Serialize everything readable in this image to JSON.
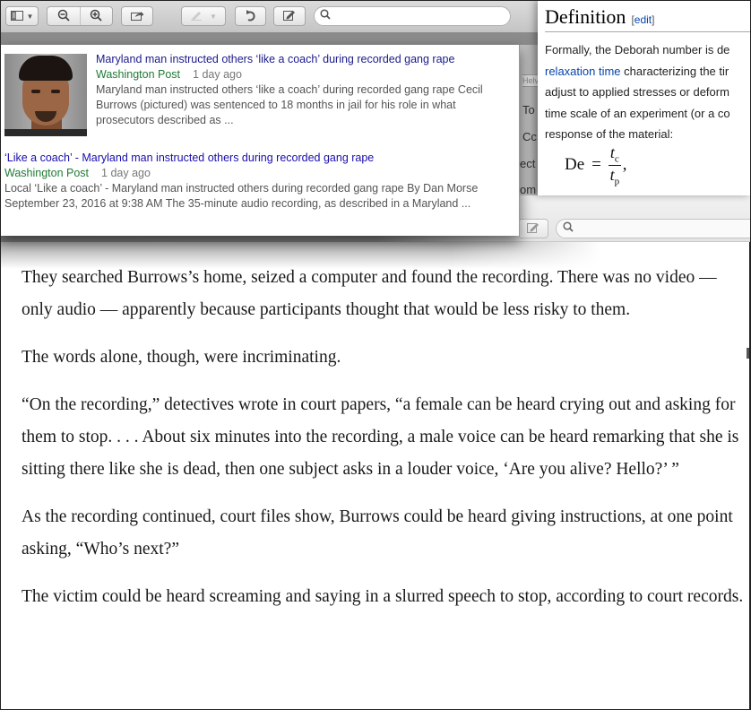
{
  "preview_toolbar": {
    "sidebar_icon": "sidebar-icon",
    "zoom_out_icon": "zoom-out-icon",
    "zoom_in_icon": "zoom-in-icon",
    "share_icon": "share-icon",
    "highlight_icon": "highlight-pen-icon",
    "rotate_icon": "rotate-icon",
    "annotate_icon": "annotate-icon",
    "search_placeholder": "",
    "search_value": ""
  },
  "news_results": [
    {
      "title": "Maryland man instructed others ‘like a coach’ during recorded gang rape",
      "source": "Washington Post",
      "time": "1 day ago",
      "snippet": "Maryland man instructed others ‘like a coach’ during recorded gang rape Cecil Burrows (pictured) was sentenced to 18 months in jail for his role in what prosecutors described as ...",
      "has_image": true,
      "image_alt": "pictured"
    },
    {
      "title": "‘Like a coach’ - Maryland man instructed others during recorded gang rape",
      "source": "Washington Post",
      "time": "1 day ago",
      "snippet": "Local ‘Like a coach’ - Maryland man instructed others during recorded gang rape By Dan Morse September 23, 2016 at 9:38 AM The 35-minute audio recording, as described in a Maryland ...",
      "has_image": false
    }
  ],
  "mail_slice": {
    "font_label": "Helv",
    "to_label": "To",
    "cc_label": "Cc",
    "subject_label": "ect",
    "from_label": "om"
  },
  "wiki": {
    "heading": "Definition",
    "edit_link": "edit",
    "lines": [
      "Formally, the Deborah number is de",
      "characterizing the tir",
      "adjust to applied stresses or deform",
      "time scale of an experiment (or a co",
      "response of the material:"
    ],
    "link_text": "relaxation time",
    "formula": {
      "lhs": "De",
      "eq": "=",
      "num_var": "t",
      "num_sub": "c",
      "den_var": "t",
      "den_sub": "p",
      "trail": ","
    }
  },
  "bg_toolbar": {
    "edit_icon": "annotate-icon",
    "search_placeholder": ""
  },
  "article": {
    "paragraphs": [
      "They searched Burrows’s home, seized a computer and found the recording. There was no video — only audio — apparently because participants thought that would be less risky to them.",
      "The words alone, though, were incriminating.",
      "“On the recording,” detectives wrote in court papers, “a female can be heard crying out and asking for them to stop. . . . About six minutes into the recording, a male voice can be heard remarking that she is sitting there like she is dead, then one subject asks in a louder voice, ‘Are you alive? Hello?’ ”",
      "As the recording continued, court files show, Burrows could be heard giving instructions, at one point asking, “Who’s next?”",
      "The victim could be heard screaming and saying in a slurred speech to stop, according to court records."
    ]
  },
  "colors": {
    "news_title": "#1a0dab",
    "news_source": "#1f7a36",
    "wiki_link": "#0645ad"
  }
}
